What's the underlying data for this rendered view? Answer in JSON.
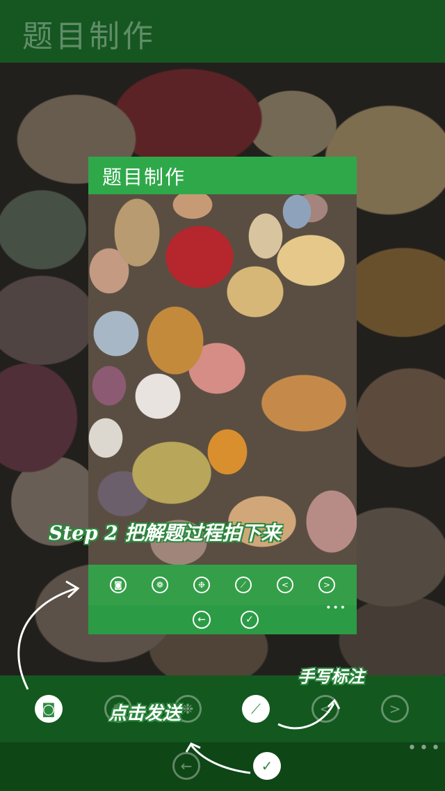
{
  "app": {
    "title": "题目制作"
  },
  "preview": {
    "title": "题目制作",
    "toolbar": {
      "row1": [
        {
          "icon": "camera-icon",
          "glyph": "◙"
        },
        {
          "icon": "album-icon",
          "glyph": "❁"
        },
        {
          "icon": "palette-icon",
          "glyph": "❉"
        },
        {
          "icon": "pen-icon",
          "glyph": "⟋"
        },
        {
          "icon": "undo-icon",
          "glyph": "<"
        },
        {
          "icon": "redo-icon",
          "glyph": ">"
        }
      ],
      "row2": [
        {
          "icon": "back-icon",
          "glyph": "←"
        },
        {
          "icon": "confirm-icon",
          "glyph": "✓"
        }
      ],
      "more": "•••"
    }
  },
  "bottom_bar": {
    "row1": [
      {
        "icon": "camera-icon",
        "glyph": "◙"
      },
      {
        "icon": "album-icon",
        "glyph": "❁"
      },
      {
        "icon": "palette-icon",
        "glyph": "❉"
      },
      {
        "icon": "pen-icon",
        "glyph": "⟋"
      },
      {
        "icon": "undo-icon",
        "glyph": "<"
      },
      {
        "icon": "redo-icon",
        "glyph": ">"
      }
    ],
    "row2": [
      {
        "icon": "back-icon",
        "glyph": "←"
      },
      {
        "icon": "confirm-icon",
        "glyph": "✓"
      }
    ],
    "more": "•••"
  },
  "annotations": {
    "step2": "Step 2 把解题过程拍下来",
    "send": "点击发送",
    "handwrite": "手写标注"
  },
  "colors": {
    "accent": "#2fa84a",
    "dark_bar": "#165c22"
  }
}
